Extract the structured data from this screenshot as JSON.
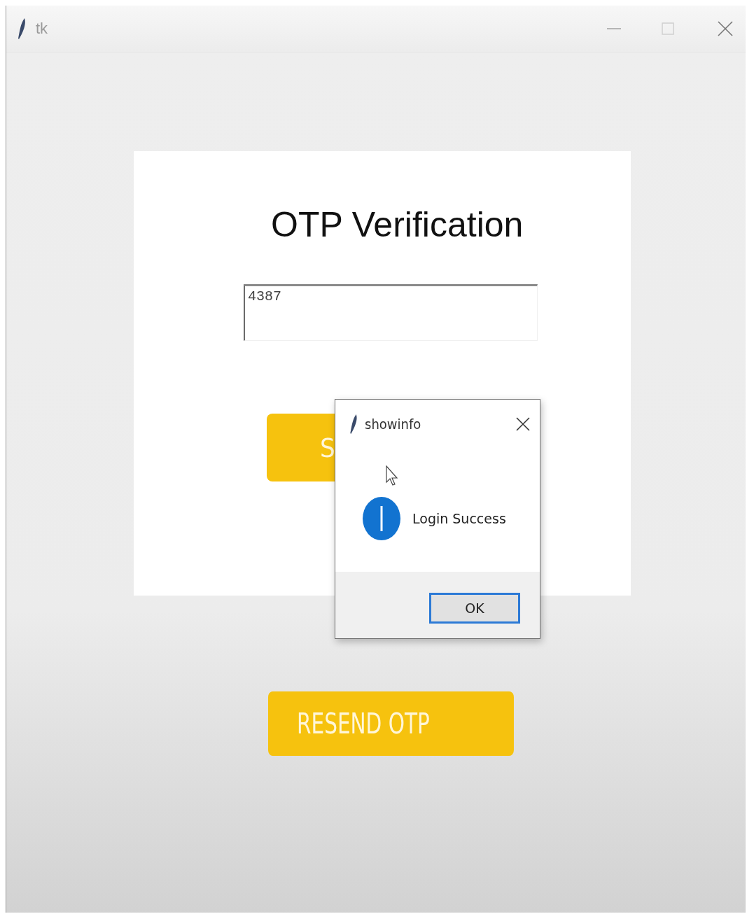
{
  "window": {
    "title": "tk"
  },
  "card": {
    "title": "OTP Verification",
    "otp_field": {
      "value": "4387"
    },
    "submit_button": {
      "label": "S"
    }
  },
  "resend_button": {
    "label": "RESEND OTP"
  },
  "dialog": {
    "title": "showinfo",
    "message": "Login Success",
    "ok_button": {
      "label": "OK"
    }
  }
}
